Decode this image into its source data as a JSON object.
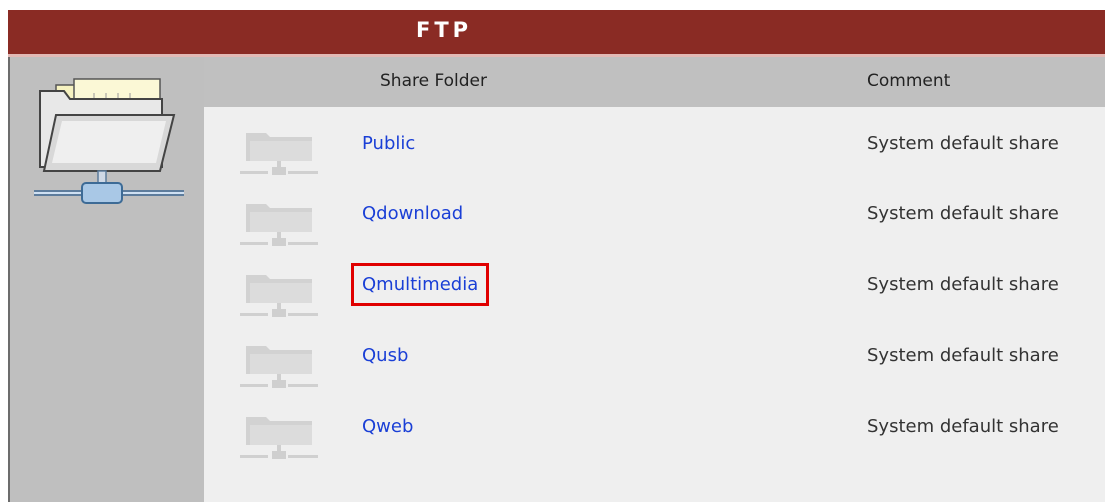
{
  "window": {
    "title": "FTP"
  },
  "columns": {
    "share_folder": "Share Folder",
    "comment": "Comment"
  },
  "icons": {
    "main": "network-share-folder-icon",
    "row": "network-share-folder-icon"
  },
  "colors": {
    "title_bar": "#8a2b24",
    "link": "#1a3fd6",
    "highlight_box": "#e00000"
  },
  "shares": [
    {
      "name": "Public",
      "comment": "System default share",
      "highlighted": false
    },
    {
      "name": "Qdownload",
      "comment": "System default share",
      "highlighted": false
    },
    {
      "name": "Qmultimedia",
      "comment": "System default share",
      "highlighted": true
    },
    {
      "name": "Qusb",
      "comment": "System default share",
      "highlighted": false
    },
    {
      "name": "Qweb",
      "comment": "System default share",
      "highlighted": false
    }
  ]
}
